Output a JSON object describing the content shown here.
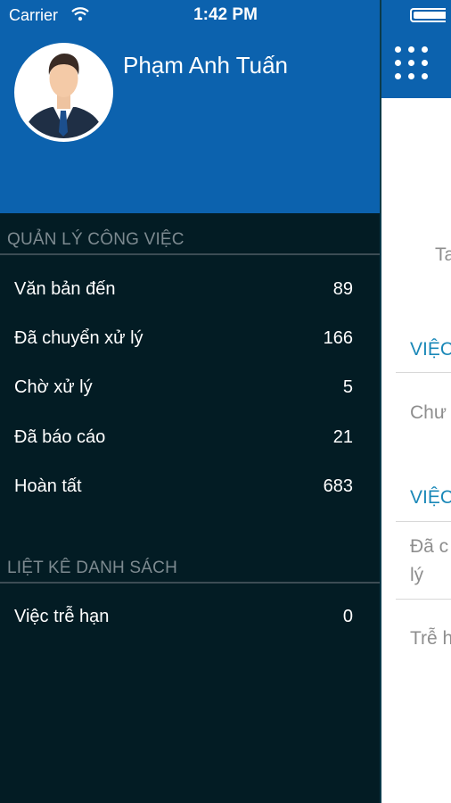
{
  "status_bar": {
    "carrier": "Carrier",
    "time": "1:42 PM"
  },
  "drawer": {
    "user_name": "Phạm Anh Tuấn",
    "sections": [
      {
        "title": "QUẢN LÝ CÔNG VIỆC",
        "items": [
          {
            "label": "Văn bản đến",
            "count": "89"
          },
          {
            "label": "Đã chuyển xử lý",
            "count": "166"
          },
          {
            "label": "Chờ xử lý",
            "count": "5"
          },
          {
            "label": "Đã báo cáo",
            "count": "21"
          },
          {
            "label": "Hoàn tất",
            "count": "683"
          }
        ]
      },
      {
        "title": "LIỆT KÊ DANH SÁCH",
        "items": [
          {
            "label": "Việc trễ hạn",
            "count": "0"
          }
        ]
      }
    ]
  },
  "main": {
    "menu_icon": "grid-icon",
    "fragments": {
      "ta": "Ta",
      "section1": "VIỆC",
      "chu": "Chư",
      "section2": "VIỆC",
      "da_c": "Đã c",
      "ly": "lý",
      "tre": "Trễ h"
    }
  },
  "colors": {
    "header_blue": "#0c62ae",
    "drawer_bg": "#031c24",
    "accent_text": "#1a88b8"
  }
}
